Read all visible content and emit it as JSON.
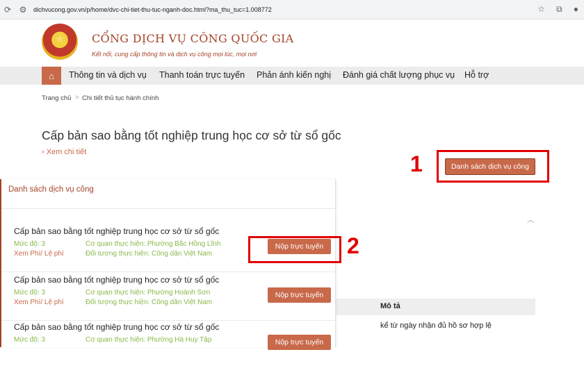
{
  "browser": {
    "url": "dichvucong.gov.vn/p/home/dvc-chi-tiet-thu-tuc-nganh-doc.html?ma_thu_tuc=1.008772"
  },
  "header": {
    "site_title": "CỔNG DỊCH VỤ CÔNG QUỐC GIA",
    "site_subtitle": "Kết nối, cung cấp thông tin và dịch vụ công mọi lúc, mọi nơi"
  },
  "menu": {
    "items": [
      {
        "label": "Thông tin và dịch vụ"
      },
      {
        "label": "Thanh toán trực tuyến"
      },
      {
        "label": "Phản ánh kiến nghị"
      },
      {
        "label": "Đánh giá chất lượng phục vụ"
      },
      {
        "label": "Hỗ trợ"
      }
    ]
  },
  "breadcrumb": {
    "home": "Trang chủ",
    "sep": ">",
    "current": "Chi tiết thủ tục hành chính"
  },
  "main": {
    "title": "Cấp bản sao bằng tốt nghiệp trung học cơ sở từ sổ gốc",
    "detail_link": "Xem chi tiết",
    "list_button": "Danh sách dịch vụ công"
  },
  "annotations": {
    "one": "1",
    "two": "2"
  },
  "panel": {
    "title": "Danh sách dịch vụ công",
    "rows": [
      {
        "title": "Cấp bản sao bằng tốt nghiệp trung học cơ sở từ sổ gốc",
        "level": "Mức độ: 3",
        "fee": "Xem Phí/ Lệ phí",
        "agency": "Cơ quan thực hiện: Phường Bắc Hồng Lĩnh",
        "target": "Đối tượng thực hiện: Công dân Việt Nam",
        "button": "Nộp trực tuyến"
      },
      {
        "title": "Cấp bản sao bằng tốt nghiệp trung học cơ sở từ sổ gốc",
        "level": "Mức độ: 3",
        "fee": "Xem Phí/ Lệ phí",
        "agency": "Cơ quan thực hiện: Phường Hoành Sơn",
        "target": "Đối tượng thực hiện: Công dân Việt Nam",
        "button": "Nộp trực tuyến"
      },
      {
        "title": "Cấp bản sao bằng tốt nghiệp trung học cơ sở từ sổ gốc",
        "level": "Mức độ: 3",
        "fee": "",
        "agency": "Cơ quan thực hiện: Phường Hà Huy Tập",
        "target": "",
        "button": "Nộp trực tuyến"
      }
    ]
  },
  "background": {
    "table_header": "Mô tả",
    "line1": "kể từ ngày nhận đủ hồ sơ hợp lệ"
  },
  "colors": {
    "brand": "#c8694a",
    "highlight": "#e00000",
    "accent_green": "#8ab84a"
  },
  "icons": [
    "back-icon",
    "forward-icon",
    "reload-icon",
    "site-info-icon",
    "star-icon",
    "extensions-icon",
    "profile-icon",
    "home-icon",
    "chevron-up-icon"
  ]
}
